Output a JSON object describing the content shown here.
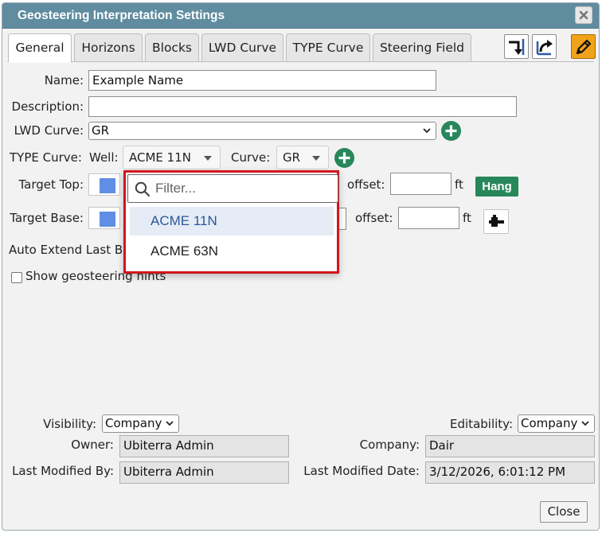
{
  "window": {
    "title": "Geosteering Interpretation Settings"
  },
  "tabs": [
    {
      "label": "General",
      "active": true
    },
    {
      "label": "Horizons"
    },
    {
      "label": "Blocks"
    },
    {
      "label": "LWD Curve"
    },
    {
      "label": "TYPE Curve"
    },
    {
      "label": "Steering Field"
    }
  ],
  "toolbar": {
    "icons": [
      "import-arrow-icon",
      "share-arrow-icon",
      "edit-pencil-icon"
    ]
  },
  "form": {
    "name_label": "Name:",
    "name_value": "Example Name",
    "description_label": "Description:",
    "description_value": "",
    "lwd_label": "LWD Curve:",
    "lwd_value": "GR",
    "type_label": "TYPE Curve:",
    "well_label": "Well:",
    "well_value": "ACME 11N",
    "curve_label": "Curve:",
    "curve_value": "GR",
    "target_top_label": "Target Top:",
    "target_base_label": "Target Base:",
    "offset_label": "offset:",
    "ft_label": "ft",
    "hang_label": "Hang",
    "auto_extend_label": "Auto Extend Last B",
    "hints_label": "Show geosteering hints",
    "swatch_color": "#5f8ee4"
  },
  "dropdown": {
    "filter_placeholder": "Filter...",
    "options": [
      "ACME 11N",
      "ACME 63N"
    ],
    "selected": "ACME 11N",
    "highlight_color": "#d2161c"
  },
  "footer": {
    "visibility_label": "Visibility:",
    "visibility_value": "Company",
    "editability_label": "Editability:",
    "editability_value": "Company",
    "owner_label": "Owner:",
    "owner_value": "Ubiterra Admin",
    "company_label": "Company:",
    "company_value": "Dair",
    "modified_by_label": "Last Modified By:",
    "modified_by_value": "Ubiterra Admin",
    "modified_date_label": "Last Modified Date:",
    "modified_date_value": "3/12/2026, 6:01:12 PM",
    "close_label": "Close"
  },
  "colors": {
    "titlebar": "#5f8c9f",
    "hang": "#27875a",
    "edit_button": "#f0a21b",
    "plus": "#27875a"
  }
}
